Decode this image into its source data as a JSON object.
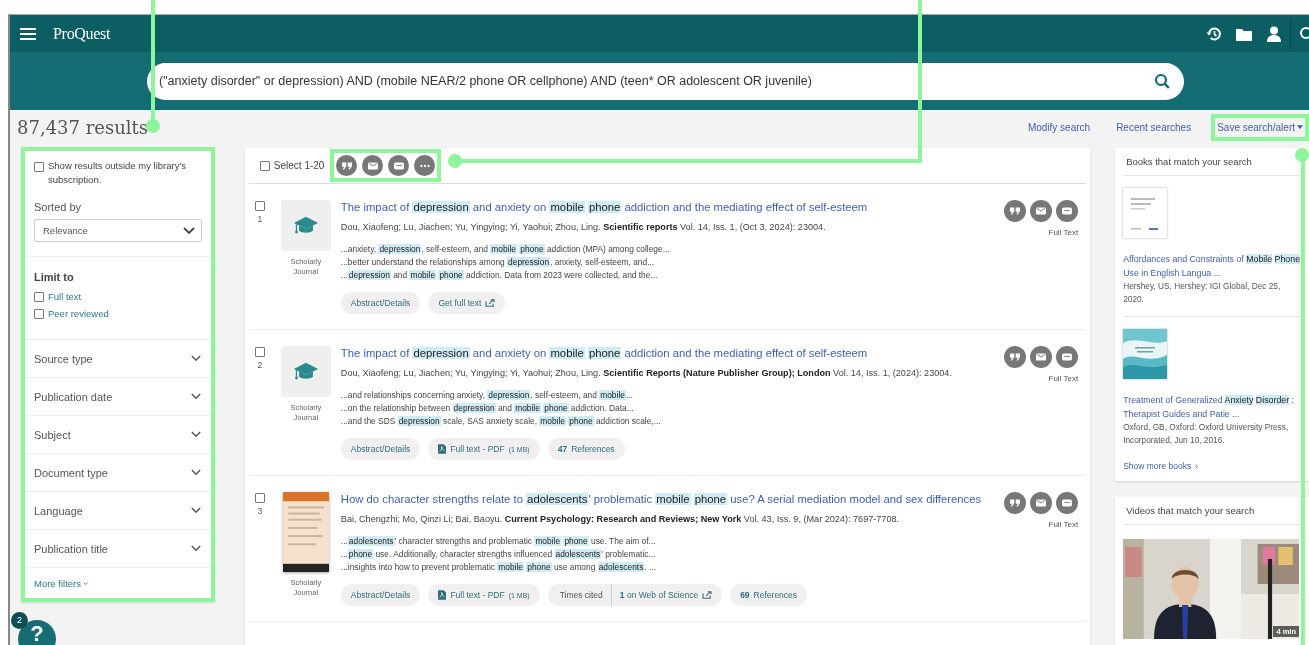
{
  "header": {
    "logo": "ProQuest"
  },
  "search": {
    "value": "(\"anxiety disorder\" or depression) AND (mobile NEAR/2 phone OR cellphone) AND (teen* OR adolescent OR juvenile)"
  },
  "results_count": "87,437 results",
  "search_links": [
    {
      "label": "Modify search",
      "highlighted": false
    },
    {
      "label": "Recent searches",
      "highlighted": false
    },
    {
      "label": "Save search/alert",
      "highlighted": true
    }
  ],
  "sidebar": {
    "highlighted": true,
    "outside_subscription": {
      "label": "Show results outside my library's subscription.",
      "checked": false
    },
    "sort": {
      "label": "Sorted by",
      "value": "Relevance"
    },
    "limit": {
      "heading": "Limit to",
      "options": [
        {
          "label": "Full text",
          "checked": false
        },
        {
          "label": "Peer reviewed",
          "checked": false
        }
      ]
    },
    "facets": [
      {
        "label": "Source type",
        "expanded": false
      },
      {
        "label": "Publication date",
        "expanded": false
      },
      {
        "label": "Subject",
        "expanded": false
      },
      {
        "label": "Document type",
        "expanded": false
      },
      {
        "label": "Language",
        "expanded": false
      },
      {
        "label": "Publication title",
        "expanded": false
      }
    ],
    "more_filters": "More filters"
  },
  "toolbar": {
    "highlighted": true,
    "select_all": {
      "label": "Select 1-20",
      "checked": false
    }
  },
  "results": [
    {
      "number": "1",
      "checked": false,
      "kind": "icon",
      "type_label": "Scholarly Journal",
      "title": "The impact of **depression** and anxiety on **mobile** **phone** addiction and the mediating effect of self-esteem",
      "meta": "Dou, Xiaofeng; Lu, Jiachen; Yu, Yingying; Yi, Yaohui; Zhou, Ling.  **Scientific reports** Vol. 14, Iss. 1,  (Oct 3, 2024): 23004.",
      "snippets": [
        "...anxiety, **depression**, self-esteem, and **mobile** **phone** addiction (MPA) among college...",
        "...better understand the relationships among **depression**, anxiety, self-esteem, and...",
        "...**depression** and **mobile** **phone** addiction. Data from 2023 were collected, and the..."
      ],
      "actions": [
        {
          "kind": "abstract",
          "label": "Abstract/Details"
        },
        {
          "kind": "external",
          "label": "Get full text"
        }
      ],
      "availability": "Full Text"
    },
    {
      "number": "2",
      "checked": false,
      "kind": "icon",
      "type_label": "Scholarly Journal",
      "title": "The impact of **depression** and anxiety on **mobile** **phone** addiction and the mediating effect of self-esteem",
      "meta": "Dou, Xiaofeng; Lu, Jiachen; Yu, Yingying; Yi, Yaohui; Zhou, Ling.  **Scientific Reports (Nature Publisher Group); London** Vol. 14, Iss. 1,  (2024): 23004.",
      "snippets": [
        "...and relationships concerning anxiety, **depression**, self-esteem, and **mobile**...",
        "...on the relationship between **depression** and **mobile** **phone** addiction. Data...",
        "...and the SDS **depression** scale, SAS anxiety scale, **mobile** **phone** addiction scale,..."
      ],
      "actions": [
        {
          "kind": "abstract",
          "label": "Abstract/Details"
        },
        {
          "kind": "pdf",
          "label": "Full text - PDF",
          "size": "(1 MB)"
        },
        {
          "kind": "references",
          "label": "**47** References"
        }
      ],
      "availability": "Full Text"
    },
    {
      "number": "3",
      "checked": false,
      "kind": "cover",
      "type_label": "Scholarly Journal",
      "title": "How do character strengths relate to **adolescents**' problematic **mobile** **phone** use? A serial mediation model and sex differences",
      "meta": "Bai, Chengzhi; Mo, Qinzi Li; Bai, Baoyu.  **Current Psychology: Research and Reviews; New York** Vol. 43, Iss. 9,  (Mar 2024): 7697-7708.",
      "snippets": [
        "...**adolescents**' character strengths and problematic **mobile** **phone** use. The aim of...",
        "...**phone** use. Additionally, character strengths influenced **adolescents**' problematic...",
        "...insights into how to prevent problematic **mobile** **phone** use among **adolescents**. ..."
      ],
      "actions": [
        {
          "kind": "abstract",
          "label": "Abstract/Details"
        },
        {
          "kind": "pdf",
          "label": "Full text - PDF",
          "size": "(1 MB)"
        },
        {
          "kind": "cited",
          "label": "Times cited",
          "value": "**1** on Web of Science"
        },
        {
          "kind": "references",
          "label": "**69** References"
        }
      ],
      "availability": "Full Text"
    }
  ],
  "books": {
    "heading": "Books that match your search",
    "items": [
      {
        "kind": "plain",
        "title": "Affordances and Constraints of **Mobile** **Phone** Use in English Langua ...",
        "meta": "Hershey, US, Hershey: IGI Global, Dec 25, 2020."
      },
      {
        "kind": "wave",
        "title": "Treatment of Generalized **Anxiety** **Disorder** : Therapist Guides and Patie ...",
        "meta": "Oxford, GB, Oxford: Oxford University Press, Incorporated, Jun 10, 2016."
      }
    ],
    "more": "Show more books"
  },
  "videos": {
    "heading": "Videos that match your search",
    "duration": "4 min"
  },
  "help": {
    "label": "?",
    "badge": "2"
  }
}
